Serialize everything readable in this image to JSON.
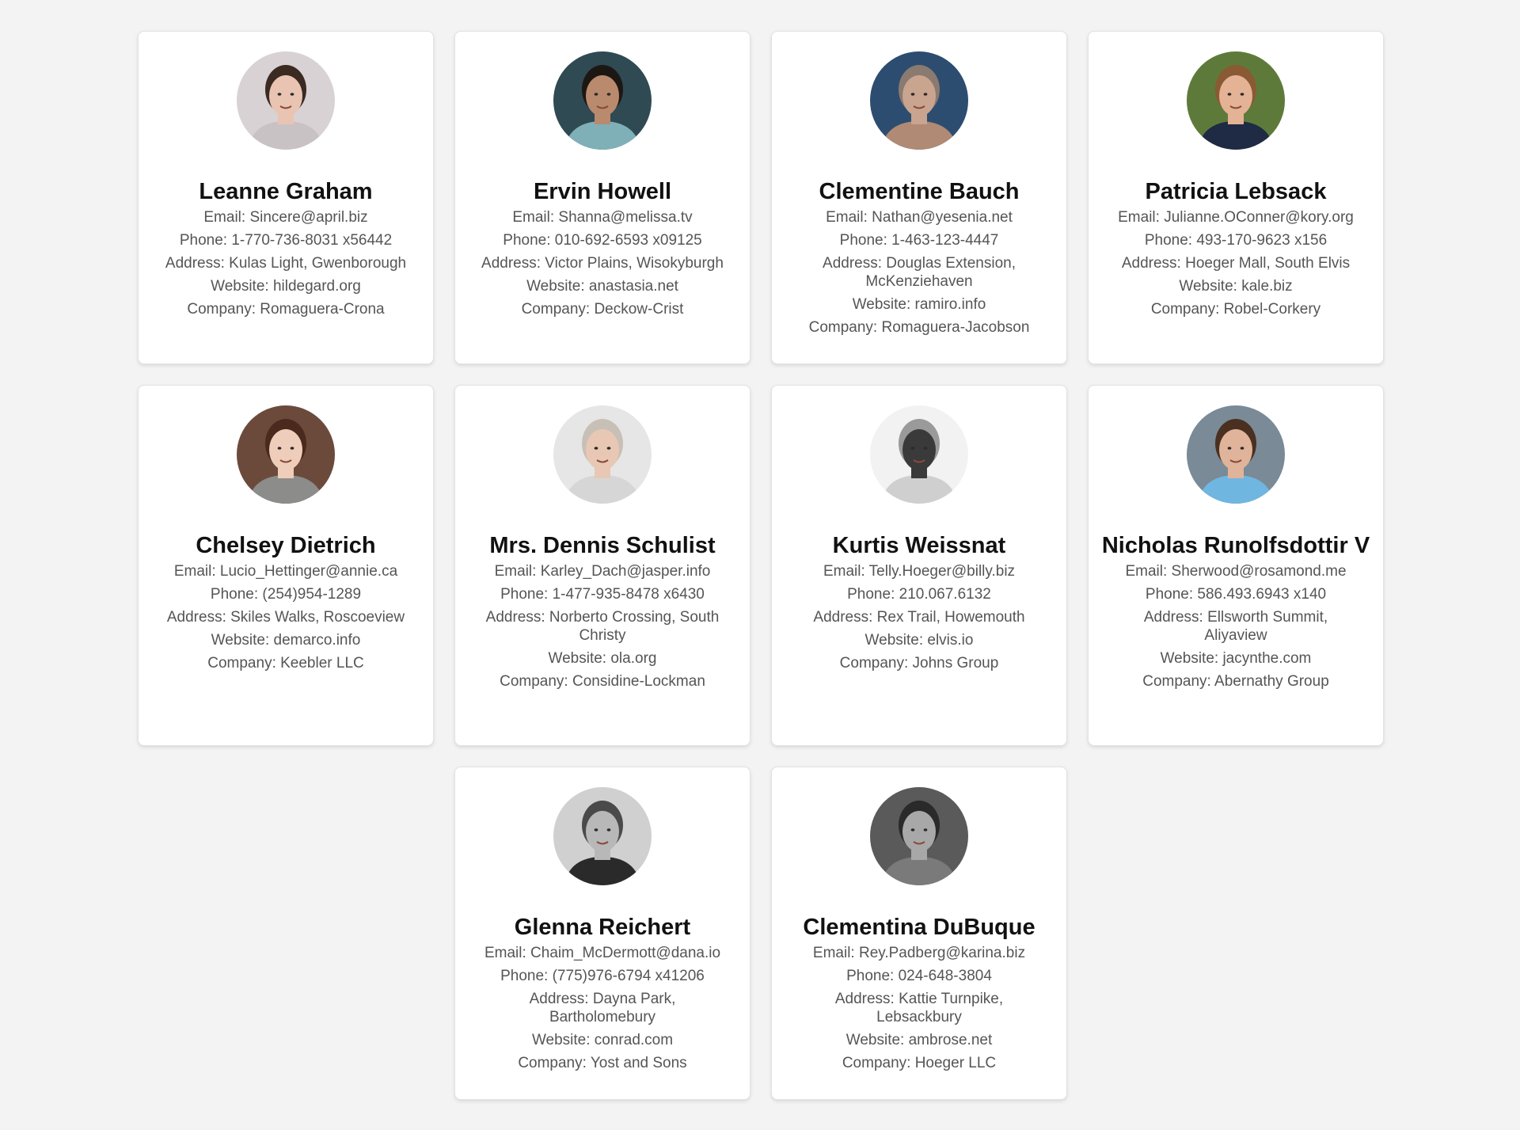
{
  "users": [
    {
      "name": "Leanne Graham",
      "email": "Email: Sincere@april.biz",
      "phone": "Phone: 1-770-736-8031 x56442",
      "address": "Address: Kulas Light, Gwenborough",
      "website": "Website: hildegard.org",
      "company": "Company: Romaguera-Crona",
      "avatar": {
        "bg": "#d8d2d4",
        "skin": "#e9c4b2",
        "hair": "#3a2a22",
        "shirt": "#c9c2c4"
      }
    },
    {
      "name": "Ervin Howell",
      "email": "Email: Shanna@melissa.tv",
      "phone": "Phone: 010-692-6593 x09125",
      "address": "Address: Victor Plains, Wisokyburgh",
      "website": "Website: anastasia.net",
      "company": "Company: Deckow-Crist",
      "avatar": {
        "bg": "#2f4a52",
        "skin": "#b98a6e",
        "hair": "#1d1713",
        "shirt": "#7fb0b8"
      }
    },
    {
      "name": "Clementine Bauch",
      "email": "Email: Nathan@yesenia.net",
      "phone": "Phone: 1-463-123-4447",
      "address": "Address: Douglas Extension, McKenziehaven",
      "website": "Website: ramiro.info",
      "company": "Company: Romaguera-Jacobson",
      "avatar": {
        "bg": "#2d4d70",
        "skin": "#c9a48e",
        "hair": "#8a7a70",
        "shirt": "#b08a74"
      }
    },
    {
      "name": "Patricia Lebsack",
      "email": "Email: Julianne.OConner@kory.org",
      "phone": "Phone: 493-170-9623 x156",
      "address": "Address: Hoeger Mall, South Elvis",
      "website": "Website: kale.biz",
      "company": "Company: Robel-Corkery",
      "avatar": {
        "bg": "#5e7a3a",
        "skin": "#e4b295",
        "hair": "#8a5a34",
        "shirt": "#1f2a44"
      }
    },
    {
      "name": "Chelsey Dietrich",
      "email": "Email: Lucio_Hettinger@annie.ca",
      "phone": "Phone: (254)954-1289",
      "address": "Address: Skiles Walks, Roscoeview",
      "website": "Website: demarco.info",
      "company": "Company: Keebler LLC",
      "avatar": {
        "bg": "#6b4a3c",
        "skin": "#efcdbb",
        "hair": "#4a2a1c",
        "shirt": "#8c8c8a"
      }
    },
    {
      "name": "Mrs. Dennis Schulist",
      "email": "Email: Karley_Dach@jasper.info",
      "phone": "Phone: 1-477-935-8478 x6430",
      "address": "Address: Norberto Crossing, South Christy",
      "website": "Website: ola.org",
      "company": "Company: Considine-Lockman",
      "avatar": {
        "bg": "#e6e6e6",
        "skin": "#e8c8b4",
        "hair": "#c8c0b6",
        "shirt": "#d6d6d6"
      }
    },
    {
      "name": "Kurtis Weissnat",
      "email": "Email: Telly.Hoeger@billy.biz",
      "phone": "Phone: 210.067.6132",
      "address": "Address: Rex Trail, Howemouth",
      "website": "Website: elvis.io",
      "company": "Company: Johns Group",
      "avatar": {
        "bg": "#f2f2f2",
        "skin": "#3a3a3a",
        "hair": "#9a9a9a",
        "shirt": "#cfcfcf"
      }
    },
    {
      "name": "Nicholas Runolfsdottir V",
      "email": "Email: Sherwood@rosamond.me",
      "phone": "Phone: 586.493.6943 x140",
      "address": "Address: Ellsworth Summit, Aliyaview",
      "website": "Website: jacynthe.com",
      "company": "Company: Abernathy Group",
      "avatar": {
        "bg": "#7a8a96",
        "skin": "#e0b49a",
        "hair": "#4a3020",
        "shirt": "#6fb6e0"
      }
    },
    {
      "name": "Glenna Reichert",
      "email": "Email: Chaim_McDermott@dana.io",
      "phone": "Phone: (775)976-6794 x41206",
      "address": "Address: Dayna Park, Bartholomebury",
      "website": "Website: conrad.com",
      "company": "Company: Yost and Sons",
      "avatar": {
        "bg": "#d0d0d0",
        "skin": "#b8b8b8",
        "hair": "#4a4a4a",
        "shirt": "#2a2a2a"
      }
    },
    {
      "name": "Clementina DuBuque",
      "email": "Email: Rey.Padberg@karina.biz",
      "phone": "Phone: 024-648-3804",
      "address": "Address: Kattie Turnpike, Lebsackbury",
      "website": "Website: ambrose.net",
      "company": "Company: Hoeger LLC",
      "avatar": {
        "bg": "#5a5a5a",
        "skin": "#a8a8a8",
        "hair": "#2a2a2a",
        "shirt": "#7a7a7a"
      }
    }
  ]
}
